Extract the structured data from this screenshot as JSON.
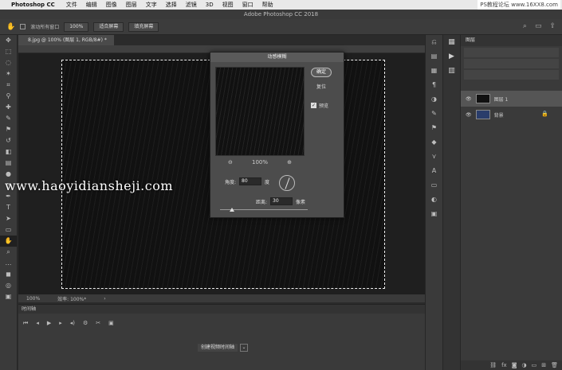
{
  "menubar": {
    "app": "Photoshop CC",
    "items": [
      "文件",
      "编辑",
      "图像",
      "图层",
      "文字",
      "选择",
      "滤镜",
      "3D",
      "视图",
      "窗口",
      "帮助"
    ],
    "watermark": "PS教程论坛 www.16XX8.com"
  },
  "window_title": "Adobe Photoshop CC 2018",
  "options": {
    "scroll_all": "滚动所有窗口",
    "zoom": "100%",
    "fit_screen": "适合屏幕",
    "fill_screen": "填充屏幕"
  },
  "doc_tab": "8.jpg @ 100% (图层 1, RGB/8#) *",
  "status": {
    "zoom": "100%",
    "doc": "效率: 100%*"
  },
  "url_watermark": "www.haoyidiansheji.com",
  "timeline": {
    "title": "时间轴",
    "create": "创建视频时间轴"
  },
  "layers": {
    "tab": "图层",
    "layer1": "图层 1",
    "background": "背景"
  },
  "dialog": {
    "title": "动感模糊",
    "ok": "确定",
    "reset": "复位",
    "preview": "预览",
    "zoom": "100%",
    "angle_label": "角度:",
    "angle_value": "80",
    "angle_unit": "度",
    "distance_label": "距离:",
    "distance_value": "30",
    "distance_unit": "像素"
  }
}
